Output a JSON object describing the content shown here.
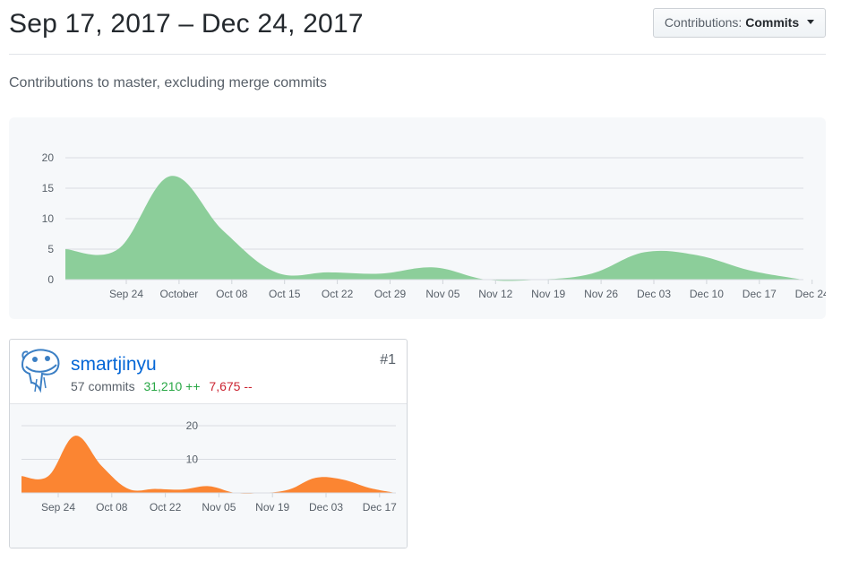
{
  "header": {
    "date_range": "Sep 17, 2017 – Dec 24, 2017",
    "button_prefix": "Contributions:",
    "button_value": "Commits"
  },
  "subtitle": "Contributions to master, excluding merge commits",
  "colors": {
    "main_area": "#8cce9a",
    "user_area": "#fb8532",
    "link": "#0366d6",
    "additions": "#28a745",
    "deletions": "#cb2431"
  },
  "chart_data": [
    {
      "type": "area",
      "x": [
        "Sep 17",
        "Sep 24",
        "Oct 01",
        "Oct 08",
        "Oct 15",
        "Oct 22",
        "Oct 29",
        "Nov 05",
        "Nov 12",
        "Nov 19",
        "Nov 26",
        "Dec 03",
        "Dec 10",
        "Dec 17",
        "Dec 24"
      ],
      "values": [
        5,
        5,
        17,
        8,
        1.2,
        1.2,
        1,
        2,
        0,
        0,
        1,
        4.5,
        4,
        1.5,
        0
      ],
      "x_tick_labels": [
        "Sep 24",
        "October",
        "Oct 08",
        "Oct 15",
        "Oct 22",
        "Oct 29",
        "Nov 05",
        "Nov 12",
        "Nov 19",
        "Nov 26",
        "Dec 03",
        "Dec 10",
        "Dec 17",
        "Dec 24"
      ],
      "y_tick_labels": [
        "0",
        "5",
        "10",
        "15",
        "20"
      ],
      "ylim": [
        0,
        20
      ],
      "grid": true
    },
    {
      "type": "area",
      "x": [
        "Sep 17",
        "Sep 24",
        "Oct 01",
        "Oct 08",
        "Oct 15",
        "Oct 22",
        "Oct 29",
        "Nov 05",
        "Nov 12",
        "Nov 19",
        "Nov 26",
        "Dec 03",
        "Dec 10",
        "Dec 17",
        "Dec 24"
      ],
      "values": [
        5,
        5,
        17,
        8,
        1.2,
        1.2,
        1,
        2,
        0,
        0,
        1,
        4.5,
        4,
        1.5,
        0
      ],
      "x_tick_labels": [
        "Sep 24",
        "Oct 08",
        "Oct 22",
        "Nov 05",
        "Nov 19",
        "Dec 03",
        "Dec 17"
      ],
      "y_tick_labels": [
        "10",
        "20"
      ],
      "ylim": [
        0,
        20
      ],
      "grid": true
    }
  ],
  "contributor": {
    "username": "smartjinyu",
    "commits": "57 commits",
    "additions": "31,210 ++",
    "deletions": "7,675 --",
    "rank": "#1",
    "avatar_icon": "cartoon-mascot-icon"
  }
}
